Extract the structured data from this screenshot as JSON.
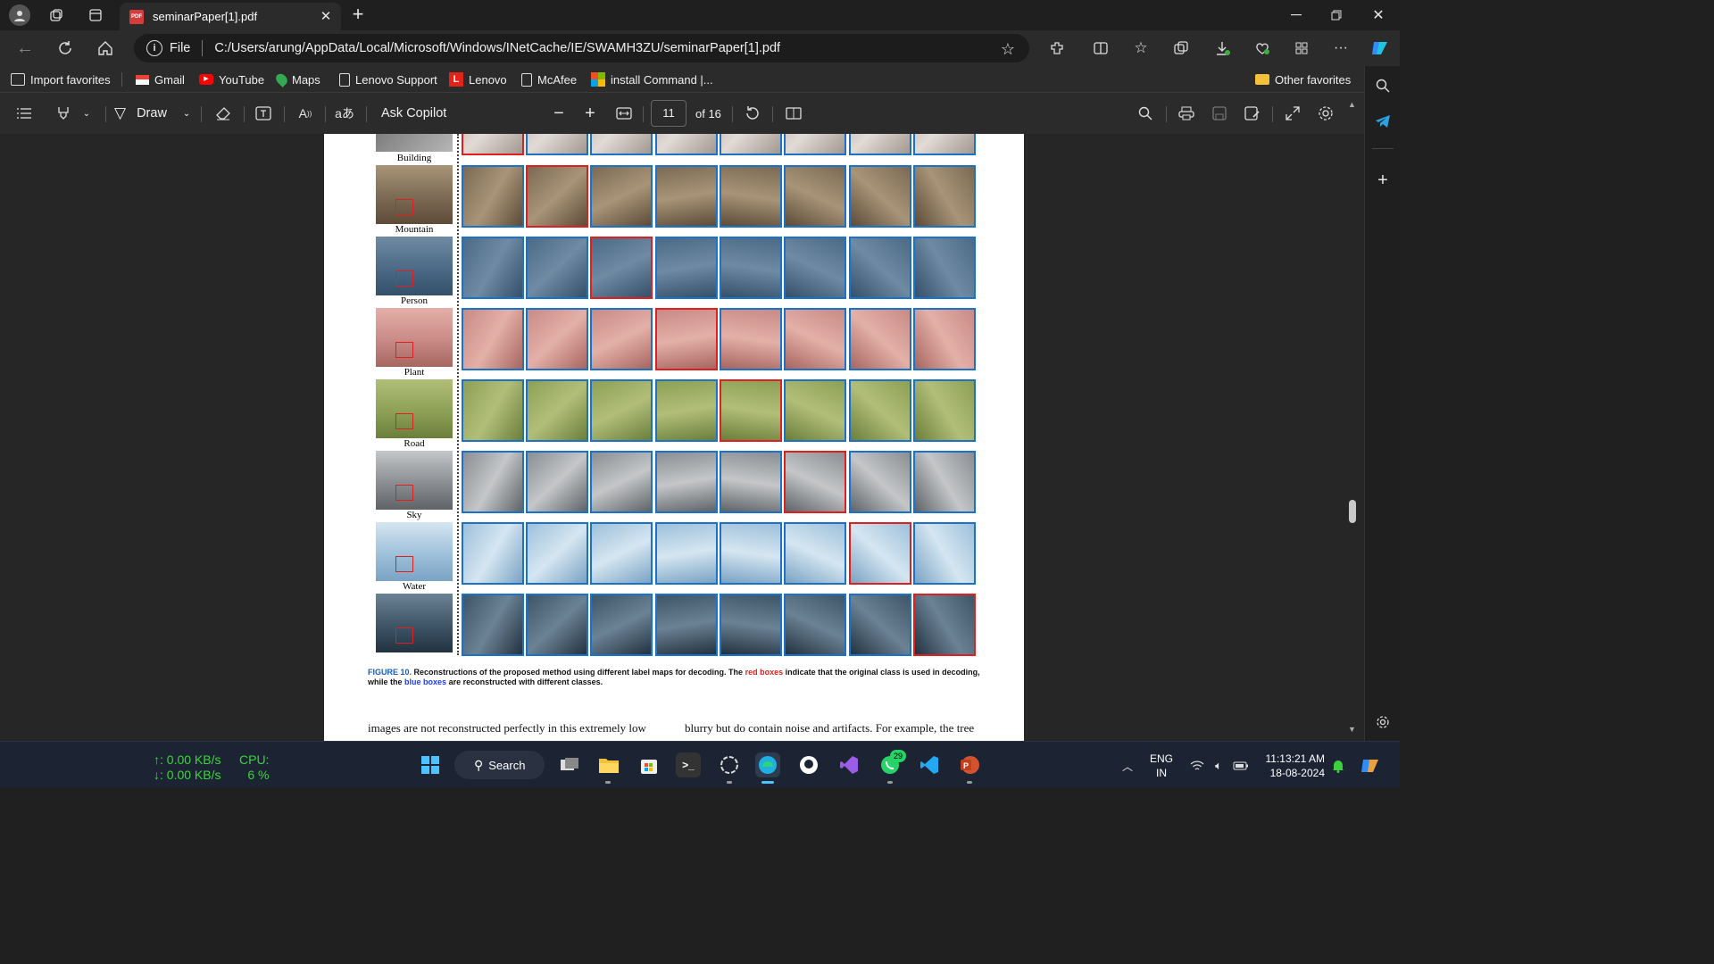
{
  "browser": {
    "tab_title": "seminarPaper[1].pdf",
    "address_prefix": "File",
    "url": "C:/Users/arung/AppData/Local/Microsoft/Windows/INetCache/IE/SWAMH3ZU/seminarPaper[1].pdf"
  },
  "favorites": {
    "items": [
      "Import favorites",
      "Gmail",
      "YouTube",
      "Maps",
      "Lenovo Support",
      "Lenovo",
      "McAfee",
      "install Command |..."
    ],
    "other": "Other favorites"
  },
  "pdf_toolbar": {
    "draw": "Draw",
    "copilot": "Ask Copilot",
    "page_number": "11",
    "page_total": "of 16"
  },
  "figure": {
    "rows": [
      "Building",
      "Mountain",
      "Person",
      "Plant",
      "Road",
      "Sky",
      "Water"
    ],
    "caption_label": "FIGURE 10.",
    "caption_a": "Reconstructions of the proposed method using different label maps for decoding. The",
    "caption_red": "red boxes",
    "caption_b": "indicate that the original class is used in decoding, while the",
    "caption_blue": "blue boxes",
    "caption_c": "are reconstructed with different classes.",
    "body_left": "images are not reconstructed perfectly in this extremely low",
    "body_right": "blurry but do contain noise and artifacts. For example, the tree"
  },
  "taskbar": {
    "net_up": "↑: 0.00 KB/s",
    "net_down": "↓: 0.00 KB/s",
    "cpu_label": "CPU:",
    "cpu_value": "6 %",
    "search": "Search",
    "whatsapp_badge": "29",
    "lang1": "ENG",
    "lang2": "IN",
    "time": "11:13:21 AM",
    "date": "18-08-2024"
  },
  "colors": {
    "red_box": "#e02020",
    "blue_box": "#1a73c8",
    "caption_accent": "#1a5fb4"
  }
}
